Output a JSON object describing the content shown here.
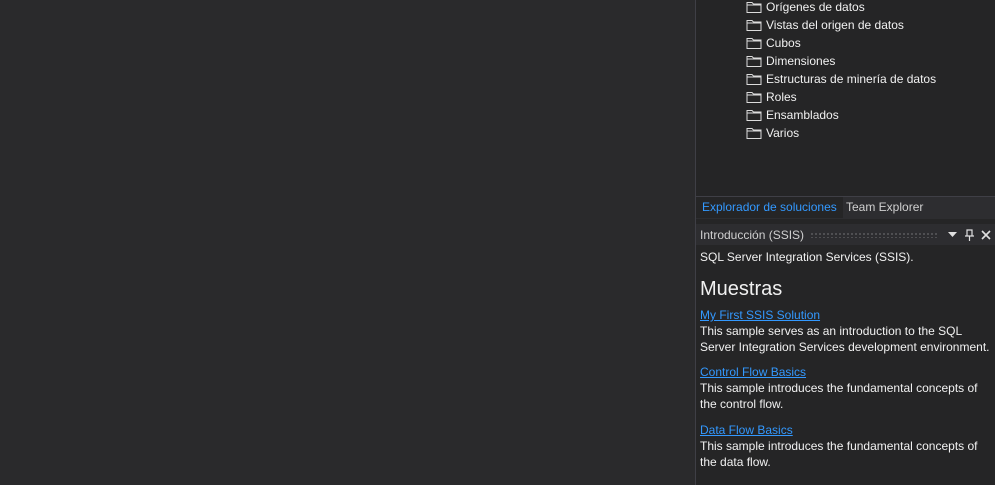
{
  "solution_explorer": {
    "items": [
      {
        "label": "Orígenes de datos",
        "icon": "folder-icon"
      },
      {
        "label": "Vistas del origen de datos",
        "icon": "folder-icon"
      },
      {
        "label": "Cubos",
        "icon": "folder-icon"
      },
      {
        "label": "Dimensiones",
        "icon": "folder-icon"
      },
      {
        "label": "Estructuras de minería de datos",
        "icon": "folder-icon"
      },
      {
        "label": "Roles",
        "icon": "folder-icon"
      },
      {
        "label": "Ensamblados",
        "icon": "folder-icon"
      },
      {
        "label": "Varios",
        "icon": "folder-icon"
      }
    ]
  },
  "tabs": [
    {
      "label": "Explorador de soluciones",
      "active": true
    },
    {
      "label": "Team Explorer",
      "active": false
    }
  ],
  "intro_panel": {
    "title": "Introducción (SSIS)",
    "intro_text": "SQL Server Integration Services (SSIS).",
    "section_title": "Muestras",
    "samples": [
      {
        "link": "My First SSIS Solution",
        "description": "This sample serves as an introduction to the SQL Server Integration Services development environment."
      },
      {
        "link": "Control Flow Basics",
        "description": "This sample introduces the fundamental concepts of the control flow."
      },
      {
        "link": "Data Flow Basics",
        "description": "This sample introduces the fundamental concepts of the data flow."
      }
    ]
  },
  "colors": {
    "background": "#2d2d30",
    "accent": "#3399ff",
    "text": "#f1f1f1"
  }
}
